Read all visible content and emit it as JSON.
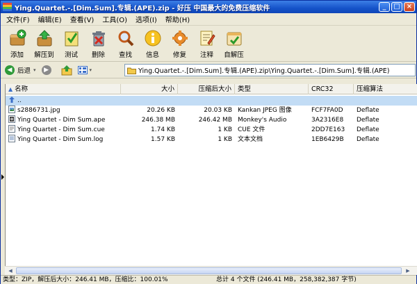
{
  "window": {
    "title": "Ying.Quartet.-.[Dim.Sum].专辑.(APE).zip - 好压 中国最大的免费压缩软件",
    "controls": [
      "_",
      "□",
      "×"
    ]
  },
  "menu": [
    "文件(F)",
    "编辑(E)",
    "查看(V)",
    "工具(O)",
    "选项(I)",
    "帮助(H)"
  ],
  "toolbar": [
    {
      "label": "添加",
      "icon": "add-icon"
    },
    {
      "label": "解压到",
      "icon": "extract-to-icon"
    },
    {
      "label": "测试",
      "icon": "test-icon"
    },
    {
      "label": "删除",
      "icon": "delete-icon"
    },
    {
      "label": "查找",
      "icon": "find-icon"
    },
    {
      "label": "信息",
      "icon": "info-icon"
    },
    {
      "label": "修复",
      "icon": "repair-icon"
    },
    {
      "label": "注释",
      "icon": "comment-icon"
    },
    {
      "label": "自解压",
      "icon": "sfx-icon"
    }
  ],
  "nav": {
    "back_label": "后退",
    "path": "Ying.Quartet.-.[Dim.Sum].专辑.(APE).zip\\Ying.Quartet.-.[Dim.Sum].专辑.(APE)"
  },
  "columns": {
    "name": "名称",
    "size": "大小",
    "packed": "压缩后大小",
    "type": "类型",
    "crc": "CRC32",
    "method": "压缩算法"
  },
  "files": [
    {
      "name": "..",
      "size": "",
      "packed": "",
      "type": "",
      "crc": "",
      "method": "",
      "icon": "parent-folder-icon",
      "selected": true
    },
    {
      "name": "s2886731.jpg",
      "size": "20.26 KB",
      "packed": "20.03 KB",
      "type": "Kankan JPEG 图像",
      "crc": "FCF7FA0D",
      "method": "Deflate",
      "icon": "image-file-icon",
      "selected": false
    },
    {
      "name": "Ying Quartet - Dim Sum.ape",
      "size": "246.38 MB",
      "packed": "246.42 MB",
      "type": "Monkey's Audio",
      "crc": "3A2316E8",
      "method": "Deflate",
      "icon": "audio-file-icon",
      "selected": false
    },
    {
      "name": "Ying Quartet - Dim Sum.cue",
      "size": "1.74 KB",
      "packed": "1 KB",
      "type": "CUE 文件",
      "crc": "2DD7E163",
      "method": "Deflate",
      "icon": "cue-file-icon",
      "selected": false
    },
    {
      "name": "Ying Quartet - Dim Sum.log",
      "size": "1.57 KB",
      "packed": "1 KB",
      "type": "文本文档",
      "crc": "1EB6429B",
      "method": "Deflate",
      "icon": "text-file-icon",
      "selected": false
    }
  ],
  "status": {
    "left": "类型：ZIP，解压后大小：246.41 MB，压缩比：100.01%",
    "right": "总计 4 个文件 (246.41 MB，258,382,387 字节)"
  }
}
